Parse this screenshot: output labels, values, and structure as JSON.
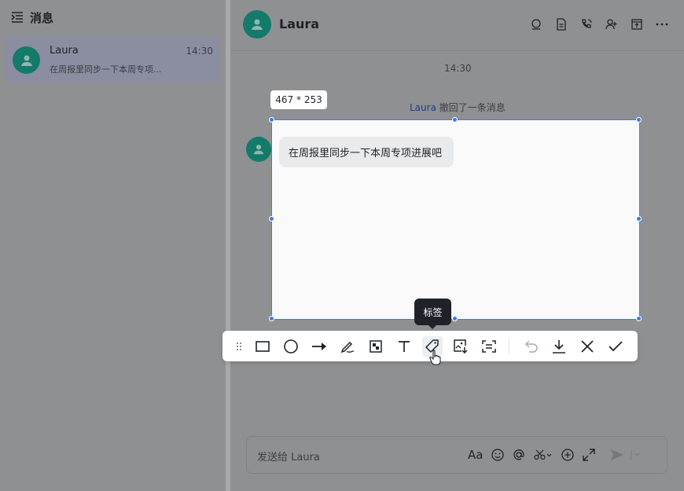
{
  "sidebar": {
    "title": "消息",
    "conversations": [
      {
        "name": "Laura",
        "time": "14:30",
        "preview": "在周报里同步一下本周专项..."
      }
    ]
  },
  "chat": {
    "contact_name": "Laura",
    "timestamp": "14:30",
    "recall_user": "Laura",
    "recall_text": " 撤回了一条消息",
    "message": "在周报里同步一下本周专项进展吧",
    "header_icons": [
      "search-icon",
      "doc-icon",
      "phone-icon",
      "add-member-icon",
      "pin-icon",
      "more-icon"
    ]
  },
  "screenshot_tool": {
    "selection_size": "467 * 253",
    "tooltip": "标签",
    "tools": [
      "drag-handle-icon",
      "rectangle-icon",
      "ellipse-icon",
      "arrow-icon",
      "pen-icon",
      "mosaic-icon",
      "text-icon",
      "tag-icon",
      "pin-image-icon",
      "ocr-icon",
      "undo-icon",
      "download-icon",
      "cancel-icon",
      "confirm-icon"
    ],
    "active_tool": "tag-icon"
  },
  "composer": {
    "placeholder": "发送给 Laura",
    "font_icon_label": "Aa"
  },
  "colors": {
    "accent": "#3c7cf5",
    "avatar": "#147a6a",
    "overlay_bg": "#8f9092",
    "tooltip_bg": "#1f2329"
  }
}
